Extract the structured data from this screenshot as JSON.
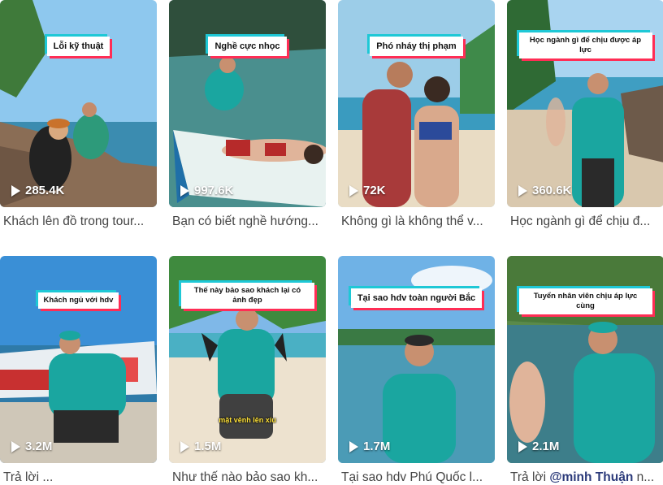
{
  "videos": [
    {
      "overlay": "Lỗi kỹ thuật",
      "views": "285.4K",
      "caption": "Khách lên đồ trong tour...",
      "mention": ""
    },
    {
      "overlay": "Nghề cực nhọc",
      "views": "997.6K",
      "caption": "Bạn có biết nghề hướng...",
      "mention": ""
    },
    {
      "overlay": "Phó nháy thị phạm",
      "views": "72K",
      "caption": "Không gì là không thể v...",
      "mention": ""
    },
    {
      "overlay": "Học ngành gì để chịu được áp lực",
      "views": "360.6K",
      "caption": "Học ngành gì để chịu đ...",
      "mention": ""
    },
    {
      "overlay": "Khách ngủ với hdv",
      "views": "3.2M",
      "caption": "Trả lời ...",
      "mention": ""
    },
    {
      "overlay": "Thế này bảo sao khách lại có ảnh đẹp",
      "views": "1.5M",
      "caption": "Như thế nào bảo sao kh...",
      "mention": "",
      "subtitle": "mặt vênh lên xíu"
    },
    {
      "overlay": "Tại sao hdv toàn người Bắc",
      "views": "1.7M",
      "caption": "Tại sao hdv Phú Quốc l...",
      "mention": ""
    },
    {
      "overlay": "Tuyển nhân viên chịu áp lực cùng",
      "views": "2.1M",
      "caption": "Trả lời ",
      "mention": "@minh Thuận",
      "caption_tail": " n..."
    }
  ],
  "colors": {
    "accent_cyan": "#1ec8d6",
    "accent_red": "#ff2d55",
    "shirt": "#1aa6a0"
  }
}
